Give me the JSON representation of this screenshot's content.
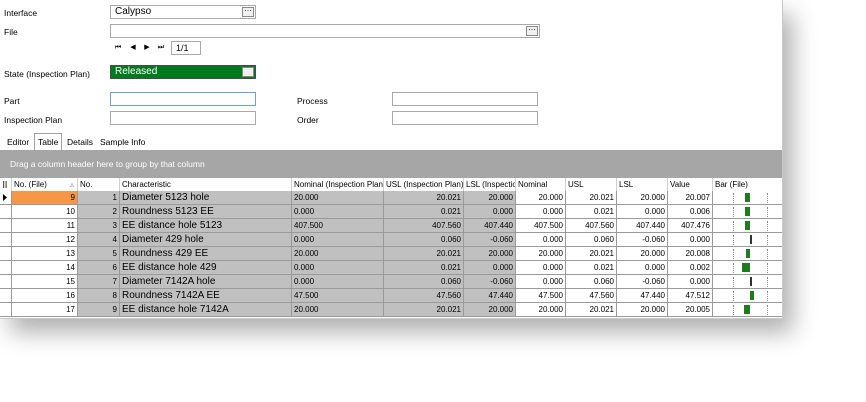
{
  "form": {
    "interface_label": "Interface",
    "interface_value": "Calypso",
    "file_label": "File",
    "file_value": "",
    "page_indicator": "1/1",
    "state_label": "State (Inspection Plan)",
    "state_value": "Released",
    "part_label": "Part",
    "part_value": "",
    "process_label": "Process",
    "process_value": "",
    "plan_label": "Inspection Plan",
    "plan_value": "",
    "order_label": "Order",
    "order_value": ""
  },
  "nav": {
    "first": "⏮",
    "prev": "◀",
    "next": "▶",
    "last": "⏭"
  },
  "tabs": [
    {
      "label": "Editor"
    },
    {
      "label": "Table"
    },
    {
      "label": "Details"
    },
    {
      "label": "Sample Info"
    }
  ],
  "group_hint": "Drag a column header here to group by that column",
  "columns": {
    "no_file": "No. (File)",
    "no": "No.",
    "characteristic": "Characteristic",
    "nominal_plan": "Nominal (Inspection Plan)",
    "usl_plan": "USL (Inspection Plan)",
    "lsl_plan": "LSL (Inspectio",
    "nominal": "Nominal",
    "usl": "USL",
    "lsl": "LSL",
    "value": "Value",
    "bar": "Bar (File)"
  },
  "rows": [
    {
      "no_file": "9",
      "no": "1",
      "characteristic": "Diameter 5123 hole",
      "nominal_plan": "20.000",
      "usl_plan": "20.021",
      "lsl_plan": "20.000",
      "nominal": "20.000",
      "usl": "20.021",
      "lsl": "20.000",
      "value": "20.007",
      "bar": 0.33
    },
    {
      "no_file": "10",
      "no": "2",
      "characteristic": "Roundness 5123 EE",
      "nominal_plan": "0.000",
      "usl_plan": "0.021",
      "lsl_plan": "0.000",
      "nominal": "0.000",
      "usl": "0.021",
      "lsl": "0.000",
      "value": "0.006",
      "bar": 0.29
    },
    {
      "no_file": "11",
      "no": "3",
      "characteristic": "EE distance hole 5123",
      "nominal_plan": "407.500",
      "usl_plan": "407.560",
      "lsl_plan": "407.440",
      "nominal": "407.500",
      "usl": "407.560",
      "lsl": "407.440",
      "value": "407.476",
      "bar": 0.3
    },
    {
      "no_file": "12",
      "no": "4",
      "characteristic": "Diameter 429 hole",
      "nominal_plan": "0.000",
      "usl_plan": "0.060",
      "lsl_plan": "-0.060",
      "nominal": "0.000",
      "usl": "0.060",
      "lsl": "-0.060",
      "value": "0.000",
      "bar": 0.5
    },
    {
      "no_file": "13",
      "no": "5",
      "characteristic": "Roundness 429 EE",
      "nominal_plan": "20.000",
      "usl_plan": "20.021",
      "lsl_plan": "20.000",
      "nominal": "20.000",
      "usl": "20.021",
      "lsl": "20.000",
      "value": "20.008",
      "bar": 0.38
    },
    {
      "no_file": "14",
      "no": "6",
      "characteristic": "EE distance hole 429",
      "nominal_plan": "0.000",
      "usl_plan": "0.021",
      "lsl_plan": "0.000",
      "nominal": "0.000",
      "usl": "0.021",
      "lsl": "0.000",
      "value": "0.002",
      "bar": 0.1
    },
    {
      "no_file": "15",
      "no": "7",
      "characteristic": "Diameter 7142A hole",
      "nominal_plan": "0.000",
      "usl_plan": "0.060",
      "lsl_plan": "-0.060",
      "nominal": "0.000",
      "usl": "0.060",
      "lsl": "-0.060",
      "value": "0.000",
      "bar": 0.5
    },
    {
      "no_file": "16",
      "no": "8",
      "characteristic": "Roundness 7142A EE",
      "nominal_plan": "47.500",
      "usl_plan": "47.560",
      "lsl_plan": "47.440",
      "nominal": "47.500",
      "usl": "47.560",
      "lsl": "47.440",
      "value": "47.512",
      "bar": 0.6
    },
    {
      "no_file": "17",
      "no": "9",
      "characteristic": "EE distance hole 7142A",
      "nominal_plan": "20.000",
      "usl_plan": "20.021",
      "lsl_plan": "20.000",
      "nominal": "20.000",
      "usl": "20.021",
      "lsl": "20.000",
      "value": "20.005",
      "bar": 0.24
    }
  ],
  "colors": {
    "state_green": "#007a1f",
    "selected_orange": "#f79646",
    "bar_green": "#1e7b1e",
    "group_gray": "#a6a6a6",
    "cell_gray": "#c0c0c0"
  }
}
